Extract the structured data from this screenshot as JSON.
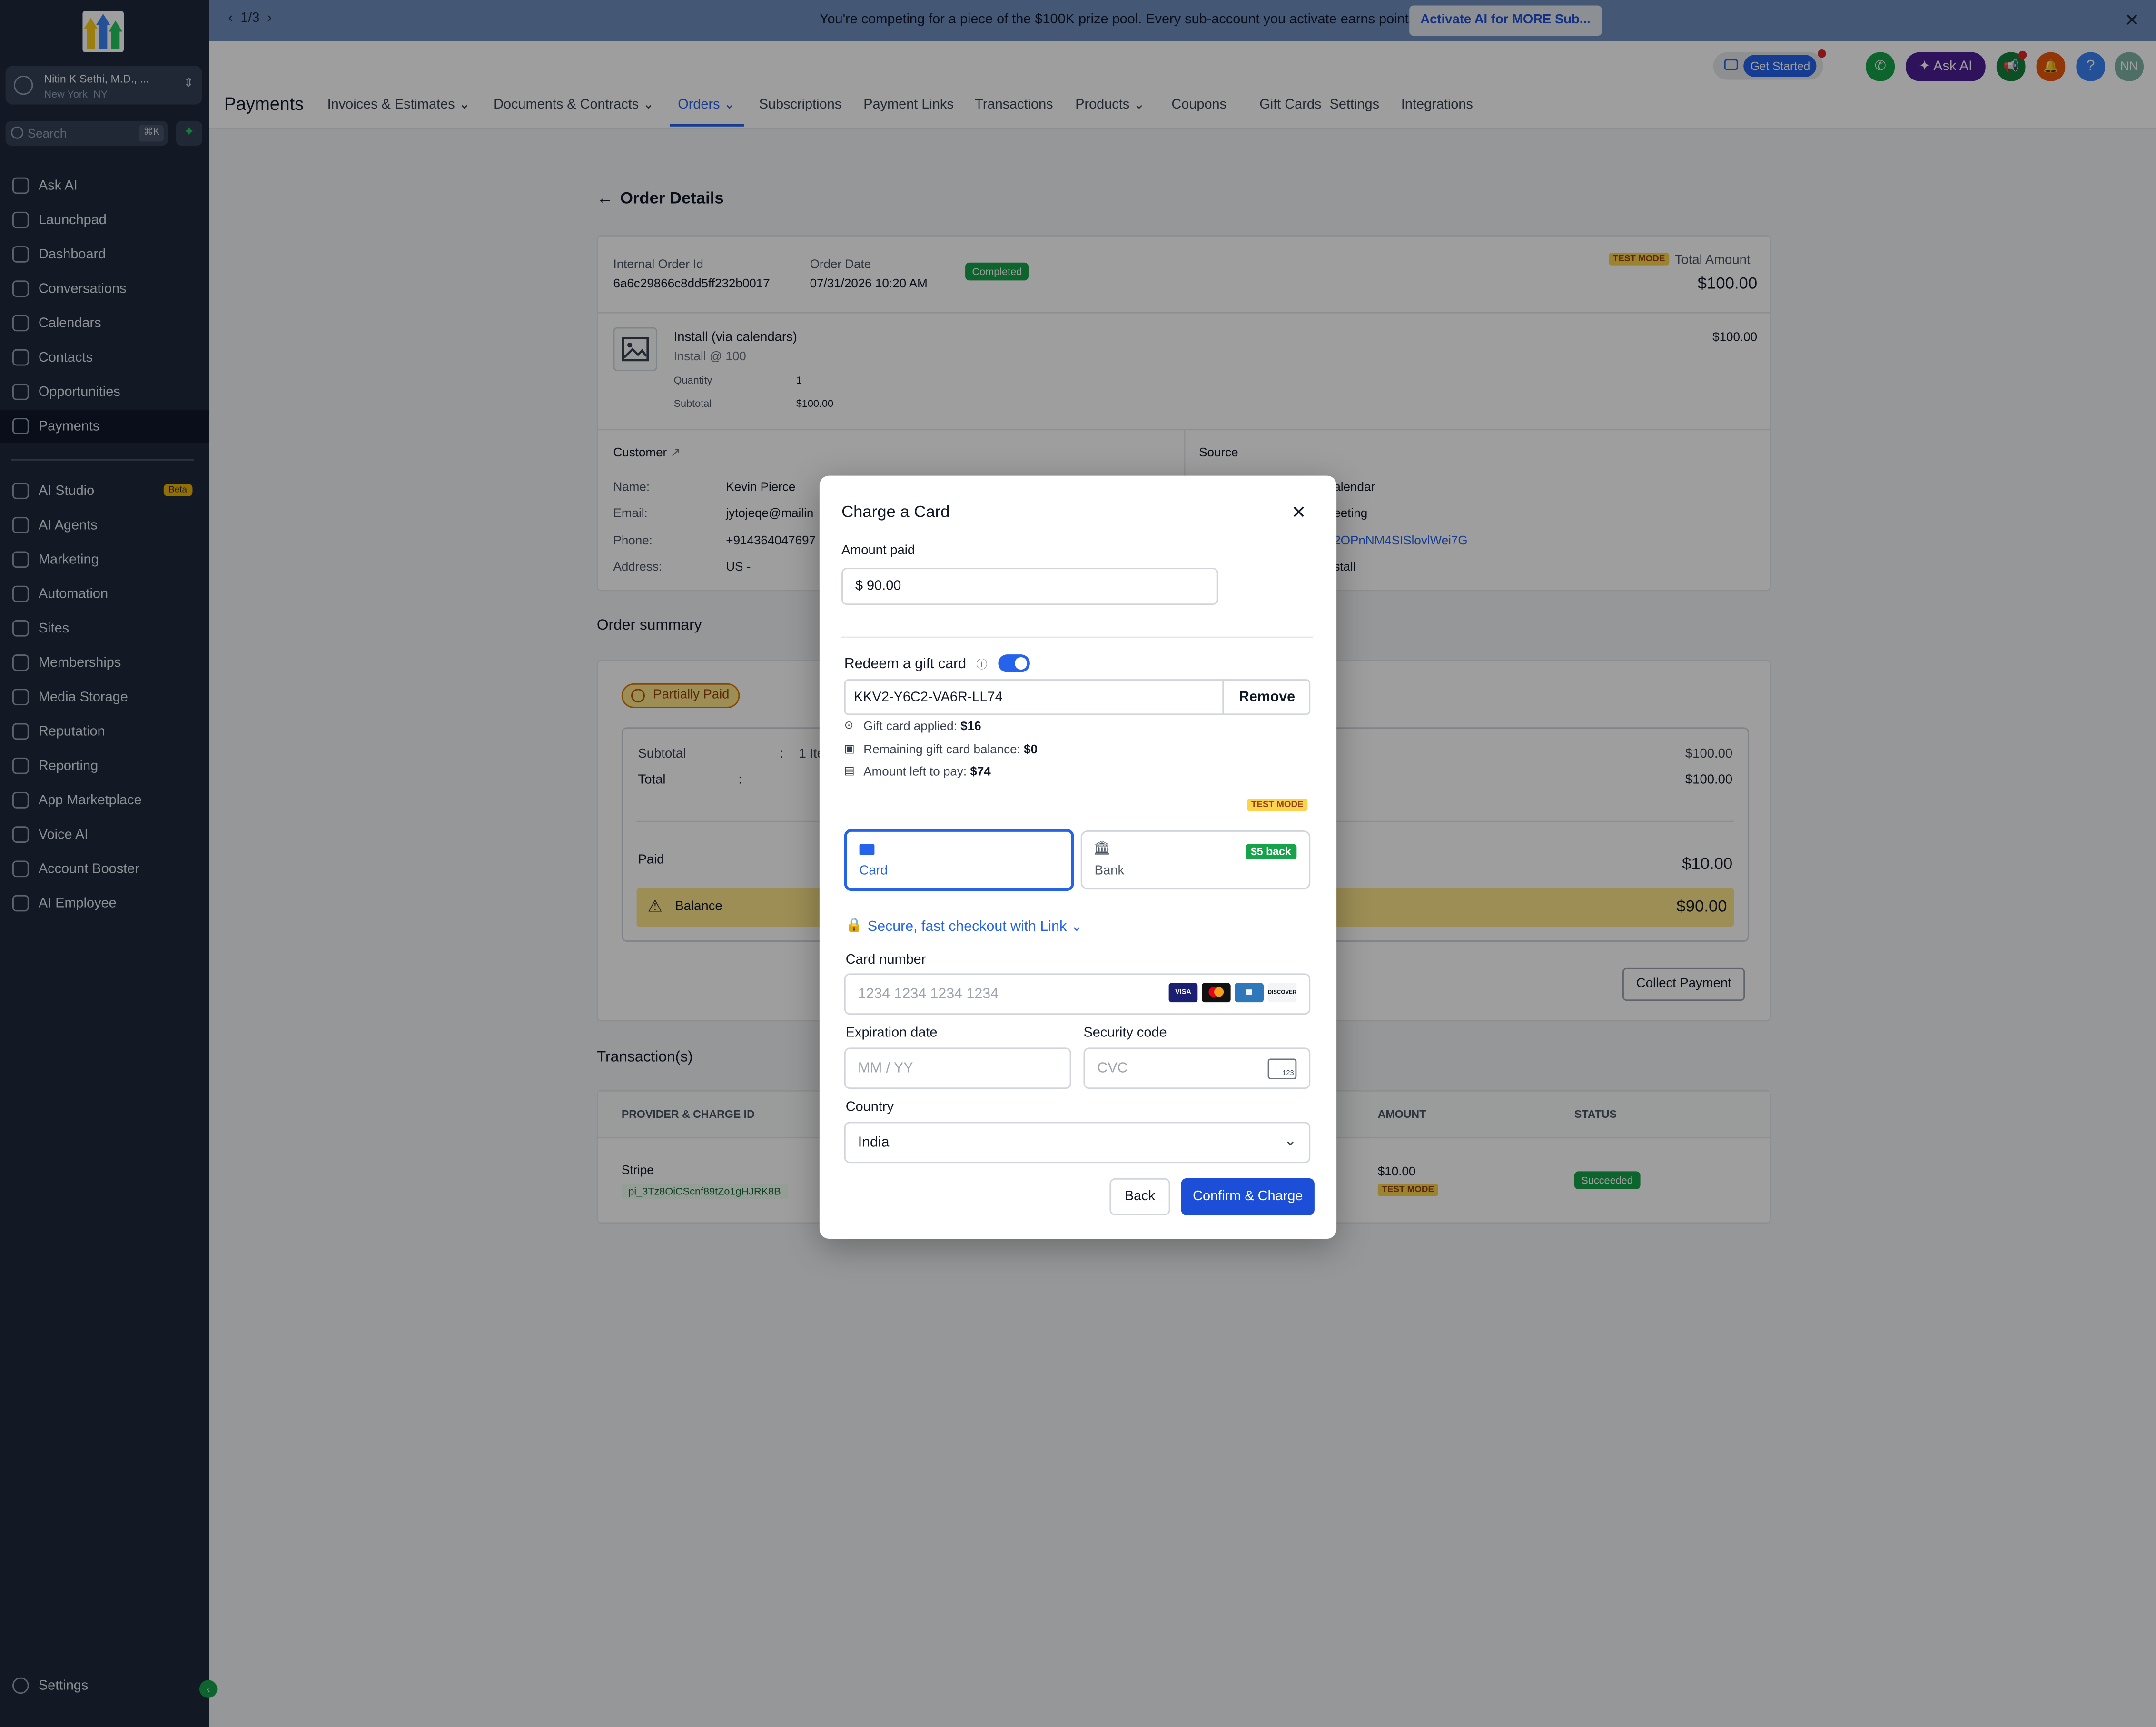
{
  "colors": {
    "sidebar_bg": "#1e293b",
    "accent": "#2563eb",
    "success": "#16a34a",
    "banner_bg": "#6e8ebf",
    "balance_bg": "#fde68a"
  },
  "sidebar": {
    "account_name": "Nitin K Sethi, M.D., ...",
    "account_location": "New York, NY",
    "search_placeholder": "Search",
    "search_shortcut": "⌘K",
    "items": [
      {
        "label": "Ask AI",
        "icon": "sparkle-icon"
      },
      {
        "label": "Launchpad",
        "icon": "rocket-icon"
      },
      {
        "label": "Dashboard",
        "icon": "grid-icon"
      },
      {
        "label": "Conversations",
        "icon": "chat-icon"
      },
      {
        "label": "Calendars",
        "icon": "calendar-icon"
      },
      {
        "label": "Contacts",
        "icon": "contacts-icon"
      },
      {
        "label": "Opportunities",
        "icon": "funnel-icon"
      },
      {
        "label": "Payments",
        "icon": "receipt-icon"
      },
      {
        "label": "AI Studio",
        "icon": "ai-studio-icon",
        "badge": "Beta"
      },
      {
        "label": "AI Agents",
        "icon": "agents-icon"
      },
      {
        "label": "Marketing",
        "icon": "send-icon"
      },
      {
        "label": "Automation",
        "icon": "automation-icon"
      },
      {
        "label": "Sites",
        "icon": "sites-icon"
      },
      {
        "label": "Memberships",
        "icon": "badge-icon"
      },
      {
        "label": "Media Storage",
        "icon": "storage-icon"
      },
      {
        "label": "Reputation",
        "icon": "star-icon"
      },
      {
        "label": "Reporting",
        "icon": "chart-icon"
      },
      {
        "label": "App Marketplace",
        "icon": "apps-icon"
      },
      {
        "label": "Voice AI",
        "icon": "phone-icon"
      },
      {
        "label": "Account Booster",
        "icon": "booster-icon"
      },
      {
        "label": "AI Employee",
        "icon": "user-icon"
      }
    ],
    "settings": "Settings"
  },
  "banner": {
    "page": "1/3",
    "message": "You're competing for a piece of the $100K prize pool. Every sub-account you activate earns points.",
    "cta": "Activate AI for MORE Sub..."
  },
  "header": {
    "title": "Payments",
    "get_started": "Get Started",
    "ask_ai": "Ask AI",
    "avatar": "NN",
    "tabs": [
      {
        "label": "Invoices & Estimates",
        "chevron": true
      },
      {
        "label": "Documents & Contracts",
        "chevron": true
      },
      {
        "label": "Orders",
        "chevron": true
      },
      {
        "label": "Subscriptions"
      },
      {
        "label": "Payment Links"
      },
      {
        "label": "Transactions"
      },
      {
        "label": "Products",
        "chevron": true
      },
      {
        "label": "Coupons"
      },
      {
        "label": "Gift Cards"
      },
      {
        "label": "Settings"
      },
      {
        "label": "Integrations"
      }
    ]
  },
  "order": {
    "title": "Order Details",
    "internal_id_label": "Internal Order Id",
    "internal_id": "6a6c29866c8dd5ff232b0017",
    "date_label": "Order Date",
    "date": "07/31/2026 10:20 AM",
    "status": "Completed",
    "test_mode": "TEST MODE",
    "total_label": "Total Amount",
    "total": "$100.00",
    "item_name": "Install (via calendars)",
    "item_sub": "Install @ 100",
    "item_price": "$100.00",
    "quantity_label": "Quantity",
    "quantity": "1",
    "subtotal_label": "Subtotal",
    "subtotal": "$100.00",
    "customer_label": "Customer",
    "name_label": "Name:",
    "name": "Kevin Pierce",
    "email_label": "Email:",
    "email": "jytojeqe@mailin",
    "phone_label": "Phone:",
    "phone": "+914364047697",
    "address_label": "Address:",
    "address": "US -",
    "source_label": "Source",
    "source_l1": "alendar",
    "source_l2": "eeting",
    "source_l3": "2OPnNM4SISlovlWei7G",
    "source_l4": "stall"
  },
  "summary": {
    "title": "Order summary",
    "status": "Partially Paid",
    "subtotal_label": "Subtotal",
    "subtotal_items": "1 Ite",
    "subtotal": "$100.00",
    "total_label": "Total",
    "total_colon": ":",
    "total": "$100.00",
    "paid_label": "Paid",
    "paid": "$10.00",
    "balance_label": "Balance",
    "balance": "$90.00",
    "collect": "Collect Payment"
  },
  "transactions": {
    "title": "Transaction(s)",
    "col_provider": "PROVIDER & CHARGE ID",
    "col_amount": "AMOUNT",
    "col_status": "STATUS",
    "provider": "Stripe",
    "charge_id": "pi_3Tz8OiCScnf89tZo1gHJRK8B",
    "amount": "$10.00",
    "test_mode": "TEST MODE",
    "status": "Succeeded"
  },
  "modal": {
    "title": "Charge a Card",
    "amount_label": "Amount paid",
    "amount_value": "$ 90.00",
    "gift_label": "Redeem a gift card",
    "gift_code": "KKV2-Y6C2-VA6R-LL74",
    "remove": "Remove",
    "applied_label": "Gift card applied:",
    "applied": "$16",
    "remaining_label": "Remaining gift card balance:",
    "remaining": "$0",
    "left_label": "Amount left to pay:",
    "left": "$74",
    "test_mode": "TEST MODE",
    "card_tab": "Card",
    "bank_tab": "Bank",
    "bank_badge": "$5 back",
    "link_text": "Secure, fast checkout with Link",
    "card_number_label": "Card number",
    "card_number_ph": "1234 1234 1234 1234",
    "brands": [
      "VISA",
      "MC",
      "AMEX",
      "DISCOVER"
    ],
    "exp_label": "Expiration date",
    "exp_ph": "MM / YY",
    "cvc_label": "Security code",
    "cvc_ph": "CVC",
    "cvc_icon_text": "123",
    "country_label": "Country",
    "country": "India",
    "back": "Back",
    "confirm": "Confirm & Charge"
  }
}
